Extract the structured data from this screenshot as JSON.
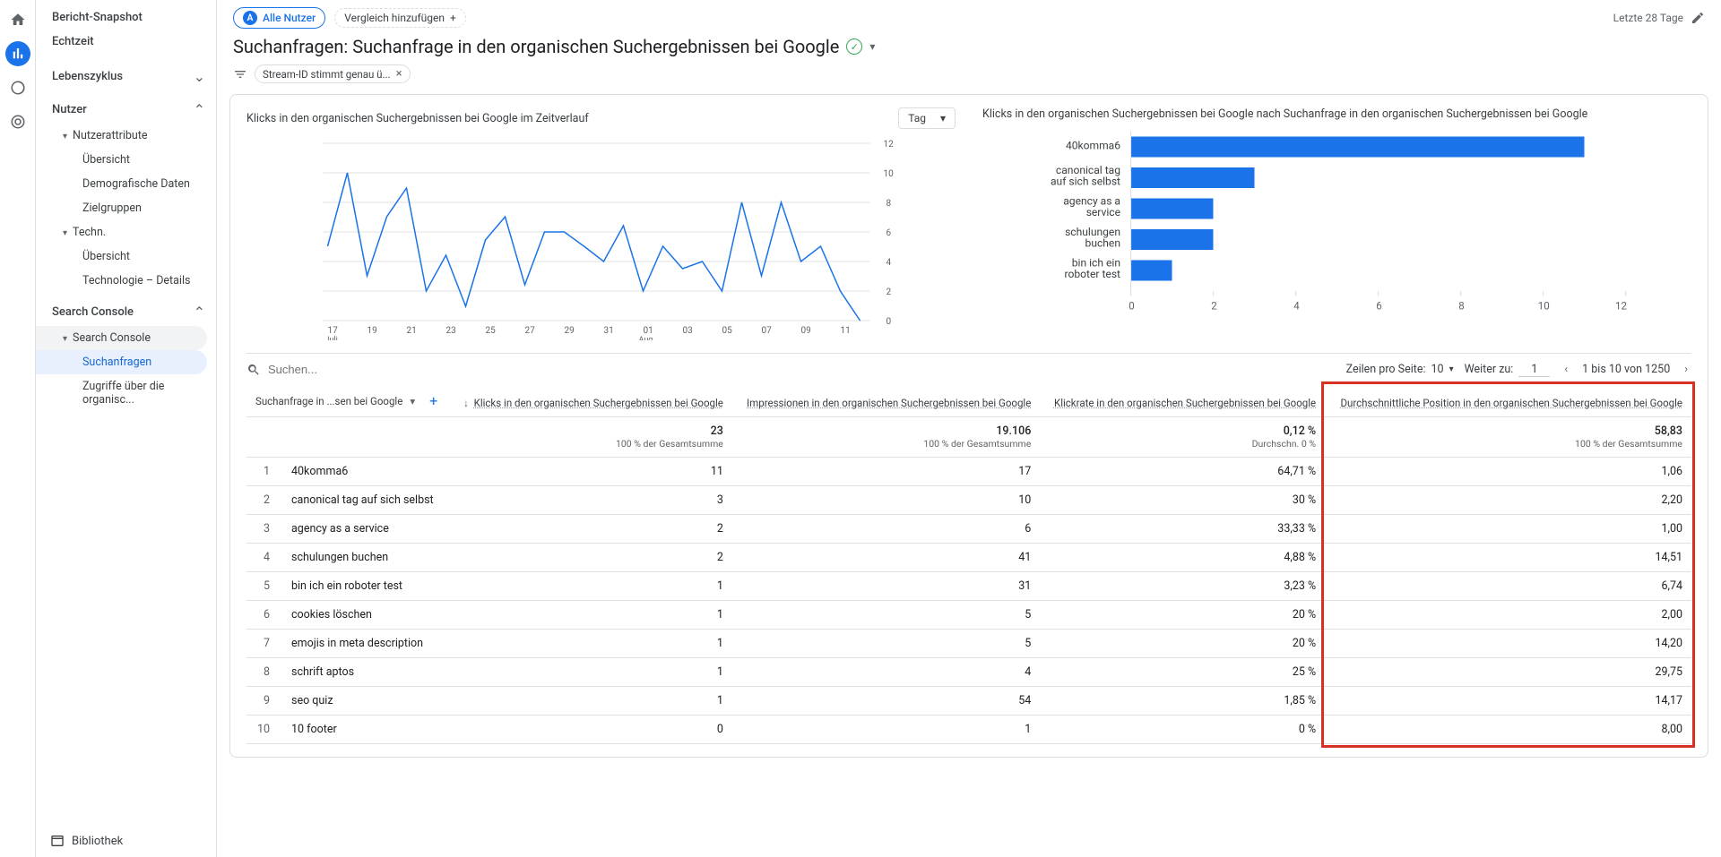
{
  "sidebar": {
    "items": [
      {
        "label": "Bericht-Snapshot"
      },
      {
        "label": "Echtzeit"
      },
      {
        "label": "Lebenszyklus"
      },
      {
        "label": "Nutzer"
      },
      {
        "label": "Nutzerattribute"
      },
      {
        "label": "Übersicht"
      },
      {
        "label": "Demografische Daten"
      },
      {
        "label": "Zielgruppen"
      },
      {
        "label": "Techn."
      },
      {
        "label": "Übersicht"
      },
      {
        "label": "Technologie – Details"
      },
      {
        "label": "Search Console"
      },
      {
        "label": "Search Console"
      },
      {
        "label": "Suchanfragen"
      },
      {
        "label": "Zugriffe über die organisc..."
      }
    ],
    "library": "Bibliothek"
  },
  "topbar": {
    "all_users": "Alle Nutzer",
    "all_users_badge": "A",
    "add_compare": "Vergleich hinzufügen",
    "date_range": "Letzte 28 Tage"
  },
  "page": {
    "title": "Suchanfragen: Suchanfrage in den organischen Suchergebnissen bei Google",
    "filter_text": "Stream-ID stimmt genau ü..."
  },
  "charts": {
    "left_title": "Klicks in den organischen Suchergebnissen bei Google im Zeitverlauf",
    "granularity": "Tag",
    "right_title": "Klicks in den organischen Suchergebnissen bei Google nach Suchanfrage in den organischen Suchergebnissen bei Google"
  },
  "chart_data": [
    {
      "type": "line",
      "title": "Klicks in den organischen Suchergebnissen bei Google im Zeitverlauf",
      "xlabel": "Juli – Aug.",
      "ylabel": "Klicks",
      "ylim": [
        0,
        12
      ],
      "x": [
        "17",
        "19",
        "21",
        "23",
        "25",
        "27",
        "29",
        "31",
        "01",
        "03",
        "05",
        "07",
        "09",
        "11"
      ],
      "x_month_labels": {
        "17": "Juli",
        "01": "Aug."
      },
      "values": [
        5,
        10,
        3,
        7,
        9,
        2,
        4.5,
        1,
        5.5,
        7,
        2.5,
        6,
        6,
        5,
        4,
        6.5,
        2,
        5,
        3.5,
        4,
        2,
        8,
        3,
        8,
        4,
        5,
        2,
        0
      ]
    },
    {
      "type": "bar",
      "title": "Klicks in den organischen Suchergebnissen bei Google nach Suchanfrage",
      "xlim": [
        0,
        12
      ],
      "categories": [
        "40komma6",
        "canonical tag auf sich selbst",
        "agency as a service",
        "schulungen buchen",
        "bin ich ein roboter test"
      ],
      "values": [
        11,
        3,
        2,
        2,
        1
      ]
    }
  ],
  "table_toolbar": {
    "search_placeholder": "Suchen...",
    "rows_label": "Zeilen pro Seite:",
    "rows_value": "10",
    "goto_label": "Weiter zu:",
    "goto_value": "1",
    "range": "1 bis 10 von 1250"
  },
  "table": {
    "dimension": "Suchanfrage in ...sen bei Google",
    "columns": [
      "Klicks in den organischen Suchergebnissen bei Google",
      "Impressionen in den organischen Suchergebnissen bei Google",
      "Klickrate in den organischen Suchergebnissen bei Google",
      "Durchschnittliche Position in den organischen Suchergebnissen bei Google"
    ],
    "totals": {
      "clicks": "23",
      "clicks_sub": "100 % der Gesamtsumme",
      "impr": "19.106",
      "impr_sub": "100 % der Gesamtsumme",
      "ctr": "0,12 %",
      "ctr_sub": "Durchschn. 0 %",
      "pos": "58,83",
      "pos_sub": "100 % der Gesamtsumme"
    },
    "rows": [
      {
        "idx": "1",
        "query": "40komma6",
        "clicks": "11",
        "impr": "17",
        "ctr": "64,71 %",
        "pos": "1,06"
      },
      {
        "idx": "2",
        "query": "canonical tag auf sich selbst",
        "clicks": "3",
        "impr": "10",
        "ctr": "30 %",
        "pos": "2,20"
      },
      {
        "idx": "3",
        "query": "agency as a service",
        "clicks": "2",
        "impr": "6",
        "ctr": "33,33 %",
        "pos": "1,00"
      },
      {
        "idx": "4",
        "query": "schulungen buchen",
        "clicks": "2",
        "impr": "41",
        "ctr": "4,88 %",
        "pos": "14,51"
      },
      {
        "idx": "5",
        "query": "bin ich ein roboter test",
        "clicks": "1",
        "impr": "31",
        "ctr": "3,23 %",
        "pos": "6,74"
      },
      {
        "idx": "6",
        "query": "cookies löschen",
        "clicks": "1",
        "impr": "5",
        "ctr": "20 %",
        "pos": "2,00"
      },
      {
        "idx": "7",
        "query": "emojis in meta description",
        "clicks": "1",
        "impr": "5",
        "ctr": "20 %",
        "pos": "14,20"
      },
      {
        "idx": "8",
        "query": "schrift aptos",
        "clicks": "1",
        "impr": "4",
        "ctr": "25 %",
        "pos": "29,75"
      },
      {
        "idx": "9",
        "query": "seo quiz",
        "clicks": "1",
        "impr": "54",
        "ctr": "1,85 %",
        "pos": "14,17"
      },
      {
        "idx": "10",
        "query": "10 footer",
        "clicks": "0",
        "impr": "1",
        "ctr": "0 %",
        "pos": "8,00"
      }
    ]
  }
}
